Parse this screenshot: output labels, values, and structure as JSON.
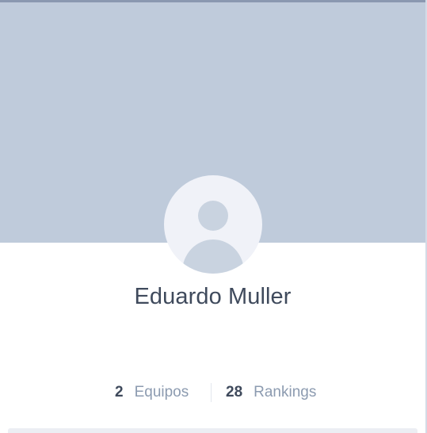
{
  "profile": {
    "name": "Eduardo Muller",
    "avatar_icon": "user-placeholder-icon"
  },
  "stats": [
    {
      "value": "2",
      "label": "Equipos"
    },
    {
      "value": "28",
      "label": "Rankings"
    }
  ],
  "colors": {
    "cover": "#bfcbdb",
    "avatar_bg": "#f0f2f8",
    "text_dark": "#3f4a5c",
    "text_muted": "#8c9bb0"
  }
}
